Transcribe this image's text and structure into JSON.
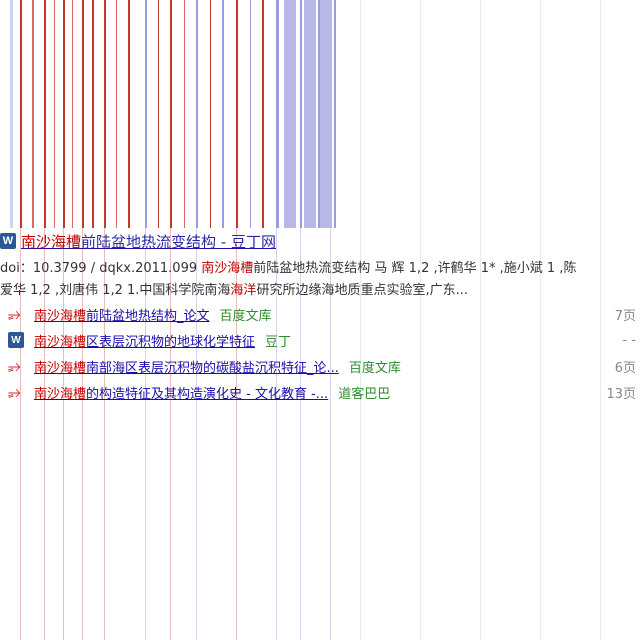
{
  "header_graphic": {
    "colors": [
      "#c0392b",
      "#b8b8e8",
      "#9a9adc",
      "#d46a6a"
    ]
  },
  "result": {
    "title_highlight": "南沙海槽",
    "title_rest": "前陆盆地热流变结构 - 豆丁网",
    "snippet_line1_prefix": "doi：10.3799 / dqkx.2011.099 ",
    "snippet_line1_hl": "南沙海槽",
    "snippet_line1_rest": "前陆盆地热流变结构 马 辉 1,2 ,许鹤华 1* ,施小斌 1 ,陈",
    "snippet_line2_prefix": "爱华 1,2 ,刘唐伟 1,2 1.中国科学院南海",
    "snippet_line2_hl": "海洋",
    "snippet_line2_rest": "研究所边缘海地质重点实验室,广东..."
  },
  "related": [
    {
      "icon": "pdf-icon",
      "hl": "南沙海槽",
      "rest": "前陆盆地热结构_论文",
      "source": "百度文库",
      "pages": "7页"
    },
    {
      "icon": "word-icon",
      "hl": "南沙海槽",
      "rest": "区表层沉积物的地球化学特征",
      "source": "豆丁",
      "pages": "- -"
    },
    {
      "icon": "pdf-icon",
      "hl": "南沙海槽",
      "rest": "南部海区表层沉积物的碳酸盐沉积特征_论...",
      "source": "百度文库",
      "pages": "6页"
    },
    {
      "icon": "pdf-icon",
      "hl": "南沙海槽",
      "rest": "的构造特征及其构造演化史 - 文化教育 -...",
      "source": "道客巴巴",
      "pages": "13页"
    }
  ]
}
